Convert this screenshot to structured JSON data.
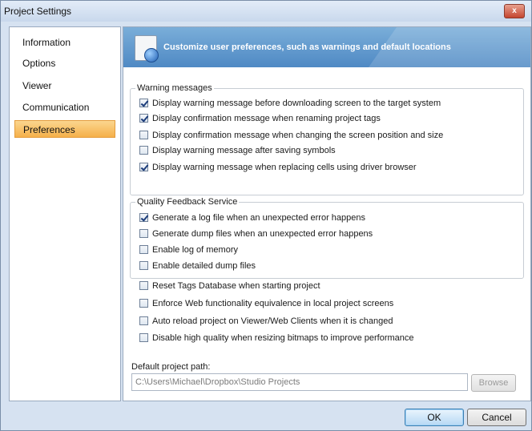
{
  "window": {
    "title": "Project Settings",
    "close_label": "x"
  },
  "sidebar": {
    "items": [
      {
        "label": "Information",
        "active": false
      },
      {
        "label": "Options",
        "active": false
      },
      {
        "label": "Viewer",
        "active": false
      },
      {
        "label": "Communication",
        "active": false
      },
      {
        "label": "Preferences",
        "active": true
      }
    ]
  },
  "banner": {
    "text": "Customize user preferences, such as warnings and default locations",
    "icon": "settings-globe-icon"
  },
  "warnings": {
    "legend": "Warning messages",
    "items": [
      {
        "label": "Display warning message before downloading screen to the target system",
        "checked": true
      },
      {
        "label": "Display confirmation message when renaming project tags",
        "checked": true
      },
      {
        "label": "Display confirmation message when changing the screen position and size",
        "checked": false
      },
      {
        "label": "Display warning message after saving symbols",
        "checked": false
      },
      {
        "label": "Display warning message when replacing cells using driver browser",
        "checked": true
      }
    ]
  },
  "quality": {
    "legend": "Quality Feedback Service",
    "items": [
      {
        "label": "Generate a log file when an unexpected error happens",
        "checked": true
      },
      {
        "label": "Generate dump files when an unexpected error happens",
        "checked": false
      },
      {
        "label": "Enable log of memory",
        "checked": false
      },
      {
        "label": "Enable detailed dump files",
        "checked": false
      }
    ]
  },
  "options": {
    "items": [
      {
        "label": "Reset Tags Database when starting project",
        "checked": false
      },
      {
        "label": "Enforce Web functionality equivalence in local project screens",
        "checked": false
      },
      {
        "label": "Auto reload project on Viewer/Web Clients when it is changed",
        "checked": false
      },
      {
        "label": "Disable high quality when resizing bitmaps to improve performance",
        "checked": false
      }
    ]
  },
  "path": {
    "label": "Default project path:",
    "value": "C:\\Users\\Michael\\Dropbox\\Studio Projects",
    "browse_label": "Browse"
  },
  "footer": {
    "ok_label": "OK",
    "cancel_label": "Cancel"
  },
  "colors": {
    "active_nav": "#f5b04a",
    "banner": "#4f89c4",
    "ok_border": "#3c7fb1"
  }
}
